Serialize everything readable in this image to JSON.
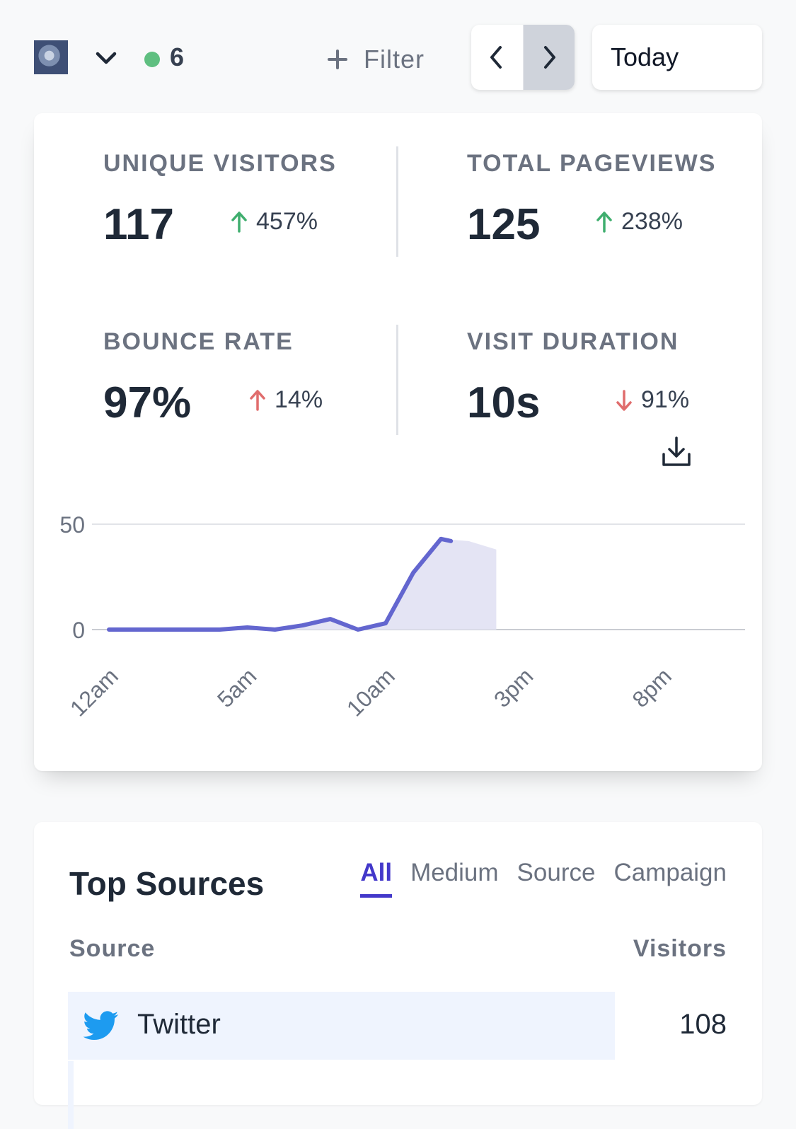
{
  "header": {
    "live_visitors": "6",
    "filter_label": "Filter",
    "period_label": "Today"
  },
  "stats": [
    {
      "label": "UNIQUE VISITORS",
      "value": "117",
      "change": "457%",
      "direction": "up",
      "color": "#3fae6e"
    },
    {
      "label": "TOTAL PAGEVIEWS",
      "value": "125",
      "change": "238%",
      "direction": "up",
      "color": "#3fae6e"
    },
    {
      "label": "BOUNCE RATE",
      "value": "97%",
      "change": "14%",
      "direction": "up",
      "color": "#e06c6c"
    },
    {
      "label": "VISIT DURATION",
      "value": "10s",
      "change": "91%",
      "direction": "down",
      "color": "#e06c6c"
    }
  ],
  "chart_data": {
    "type": "line",
    "x": [
      0,
      1,
      2,
      3,
      4,
      5,
      6,
      7,
      8,
      9,
      10,
      11,
      12,
      13,
      14
    ],
    "tick_labels": [
      "12am",
      "5am",
      "10am",
      "3pm",
      "8pm"
    ],
    "tick_hours": [
      0,
      5,
      10,
      15,
      20
    ],
    "series": [
      {
        "values": [
          0,
          0,
          0,
          0,
          0,
          1,
          0,
          2,
          5,
          0,
          3,
          27,
          43,
          42,
          38
        ]
      }
    ],
    "solid_until_index": 12,
    "ylim": [
      0,
      50
    ],
    "yticks": [
      0,
      50
    ],
    "grid": true,
    "line_color": "#6366cf",
    "fill_color": "#e4e4f4"
  },
  "sources": {
    "title": "Top Sources",
    "tabs": [
      "All",
      "Medium",
      "Source",
      "Campaign"
    ],
    "active_tab": "All",
    "col_source": "Source",
    "col_visitors": "Visitors",
    "rows": [
      {
        "name": "Twitter",
        "visitors": "108",
        "share": 0.83,
        "icon": "twitter-icon"
      }
    ]
  }
}
